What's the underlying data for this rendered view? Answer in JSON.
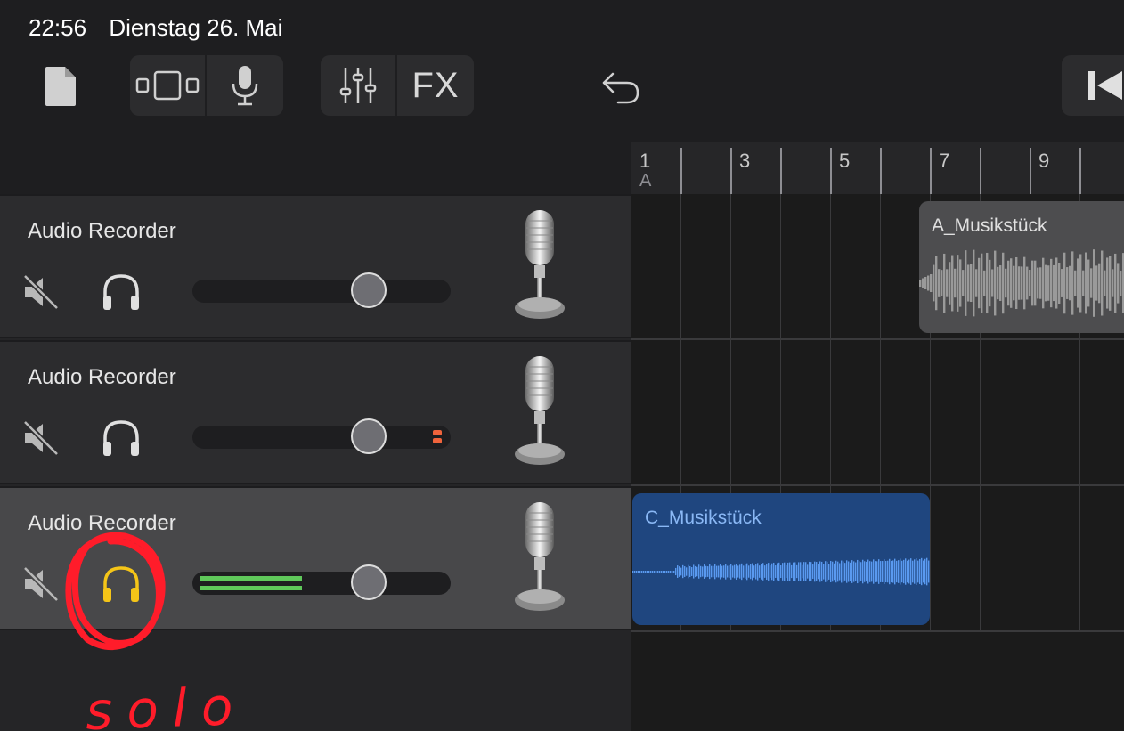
{
  "status_bar": {
    "time": "22:56",
    "date": "Dienstag 26. Mai"
  },
  "toolbar": {
    "fx_label": "FX"
  },
  "ruler": {
    "marks": [
      "1",
      "3",
      "5",
      "7",
      "9"
    ],
    "section_label": "A"
  },
  "tracks": [
    {
      "name": "Audio Recorder",
      "mute": false,
      "solo": false,
      "level": null
    },
    {
      "name": "Audio Recorder",
      "mute": false,
      "solo": false,
      "level": "clip"
    },
    {
      "name": "Audio Recorder",
      "mute": false,
      "solo": true,
      "level": 0.42,
      "selected": true
    }
  ],
  "regions": [
    {
      "name": "A_Musikstück",
      "track": 1,
      "color": "#4d4d4f"
    },
    {
      "name": "C_Musikstück",
      "track": 3,
      "color": "#1f467f"
    }
  ],
  "annotation": {
    "text": "solo",
    "color": "#ff1c2a"
  },
  "colors": {
    "solo_active": "#f5c518",
    "meter_green": "#5fc85a",
    "clip_red": "#f0643c"
  }
}
